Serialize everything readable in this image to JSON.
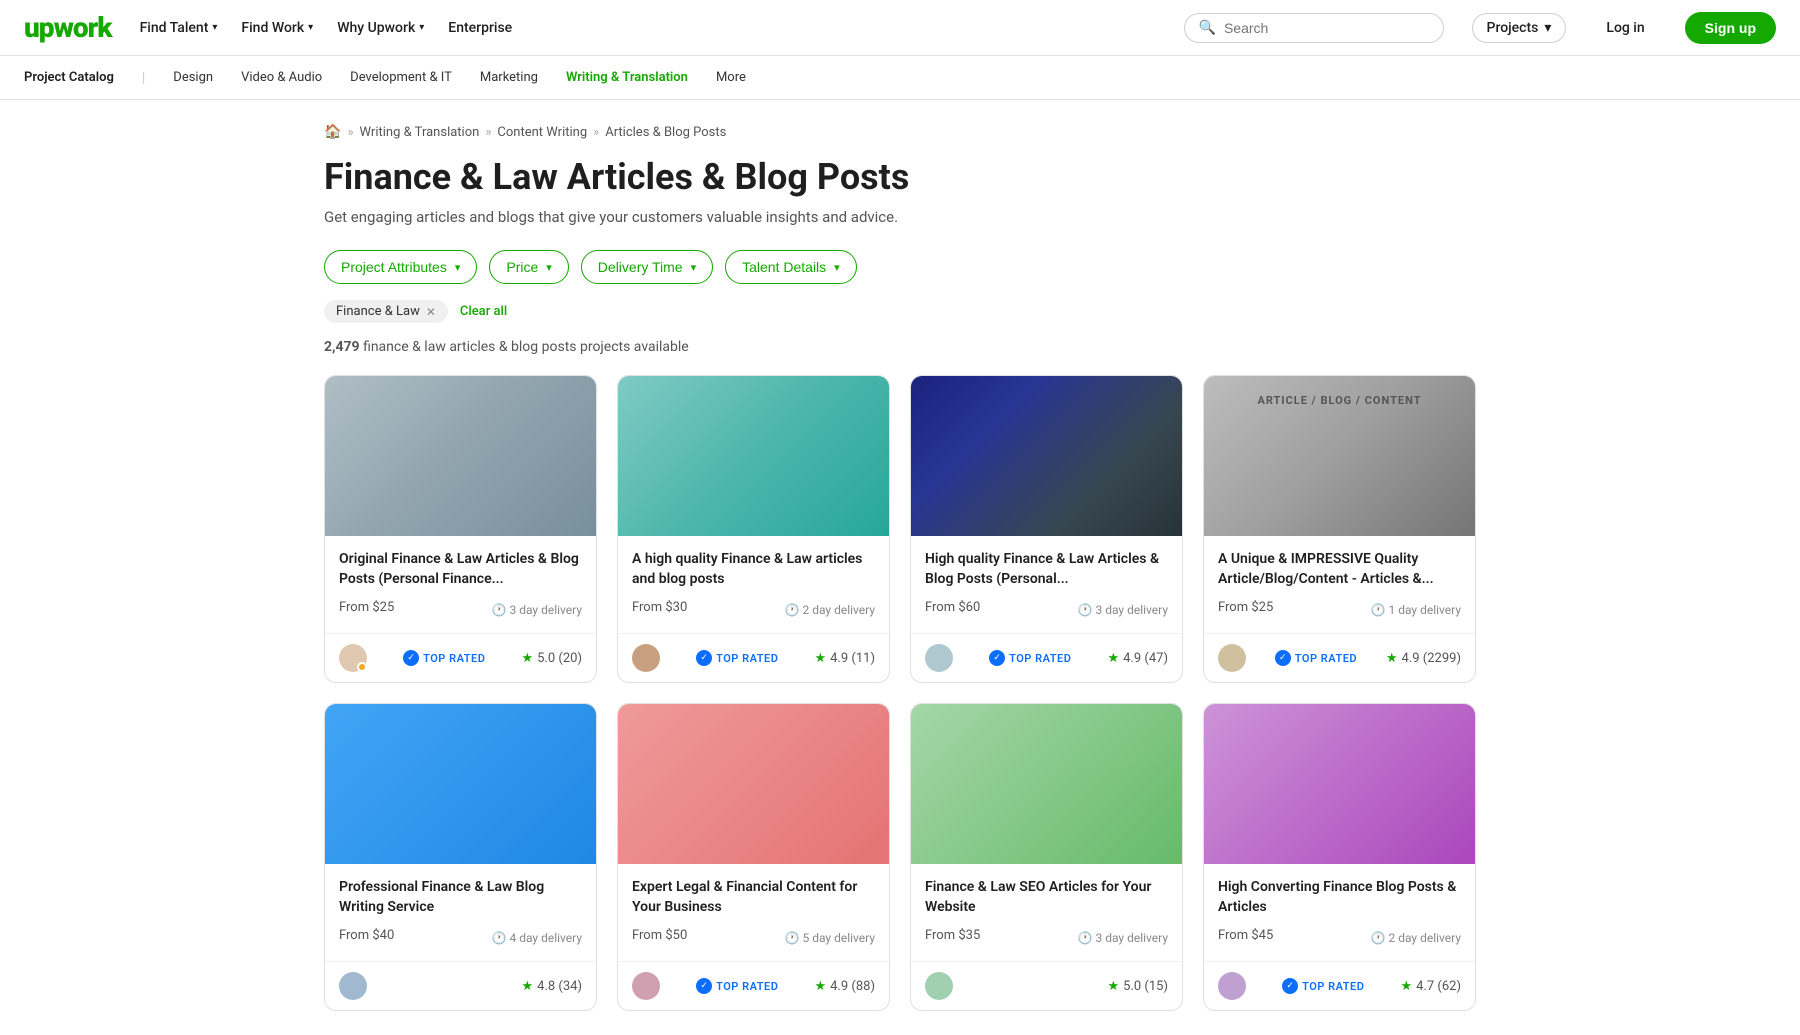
{
  "brand": {
    "logo": "upwork",
    "logo_symbol": "🔼"
  },
  "nav": {
    "links": [
      {
        "label": "Find Talent",
        "has_dropdown": true
      },
      {
        "label": "Find Work",
        "has_dropdown": true
      },
      {
        "label": "Why Upwork",
        "has_dropdown": true
      },
      {
        "label": "Enterprise",
        "has_dropdown": false
      }
    ],
    "search_placeholder": "Search",
    "projects_dropdown": "Projects",
    "login_label": "Log in",
    "signup_label": "Sign up"
  },
  "category_nav": {
    "prefix": "Project Catalog",
    "links": [
      {
        "label": "Design"
      },
      {
        "label": "Video & Audio"
      },
      {
        "label": "Development & IT"
      },
      {
        "label": "Marketing"
      },
      {
        "label": "Writing & Translation",
        "active": true
      },
      {
        "label": "More"
      }
    ]
  },
  "breadcrumb": {
    "items": [
      {
        "label": "Home",
        "is_home": true
      },
      {
        "label": "Writing & Translation"
      },
      {
        "label": "Content Writing"
      },
      {
        "label": "Articles & Blog Posts"
      }
    ]
  },
  "page": {
    "title": "Finance & Law Articles & Blog Posts",
    "subtitle": "Get engaging articles and blogs that give your customers valuable insights and advice."
  },
  "filters": [
    {
      "label": "Project Attributes",
      "id": "project-attributes"
    },
    {
      "label": "Price",
      "id": "price"
    },
    {
      "label": "Delivery Time",
      "id": "delivery-time"
    },
    {
      "label": "Talent Details",
      "id": "talent-details"
    }
  ],
  "active_filters": [
    {
      "label": "Finance & Law"
    }
  ],
  "clear_all_label": "Clear all",
  "results": {
    "count": "2,479",
    "description": "finance & law articles & blog posts projects available"
  },
  "cards": [
    {
      "id": 1,
      "title": "Original Finance & Law Articles & Blog Posts (Personal Finance...",
      "price": "From $25",
      "delivery": "3 day delivery",
      "rating": "5.0",
      "rating_count": "20",
      "top_rated": true,
      "img_class": "card-img-1"
    },
    {
      "id": 2,
      "title": "A high quality Finance & Law articles and blog posts",
      "price": "From $30",
      "delivery": "2 day delivery",
      "rating": "4.9",
      "rating_count": "11",
      "top_rated": true,
      "img_class": "card-img-2"
    },
    {
      "id": 3,
      "title": "High quality Finance & Law Articles & Blog Posts (Personal...",
      "price": "From $60",
      "delivery": "3 day delivery",
      "rating": "4.9",
      "rating_count": "47",
      "top_rated": true,
      "img_class": "card-img-3"
    },
    {
      "id": 4,
      "title": "A Unique & IMPRESSIVE Quality Article/Blog/Content - Articles &...",
      "price": "From $25",
      "delivery": "1 day delivery",
      "rating": "4.9",
      "rating_count": "2299",
      "top_rated": true,
      "img_class": "card-img-4"
    },
    {
      "id": 5,
      "title": "Professional Finance & Law Blog Writing Service",
      "price": "From $40",
      "delivery": "4 day delivery",
      "rating": "4.8",
      "rating_count": "34",
      "top_rated": false,
      "img_class": "card-img-5"
    },
    {
      "id": 6,
      "title": "Expert Legal & Financial Content for Your Business",
      "price": "From $50",
      "delivery": "5 day delivery",
      "rating": "4.9",
      "rating_count": "88",
      "top_rated": true,
      "img_class": "card-img-6"
    },
    {
      "id": 7,
      "title": "Finance & Law SEO Articles for Your Website",
      "price": "From $35",
      "delivery": "3 day delivery",
      "rating": "5.0",
      "rating_count": "15",
      "top_rated": false,
      "img_class": "card-img-7"
    },
    {
      "id": 8,
      "title": "High Converting Finance Blog Posts & Articles",
      "price": "From $45",
      "delivery": "2 day delivery",
      "rating": "4.7",
      "rating_count": "62",
      "top_rated": true,
      "img_class": "card-img-8"
    }
  ]
}
